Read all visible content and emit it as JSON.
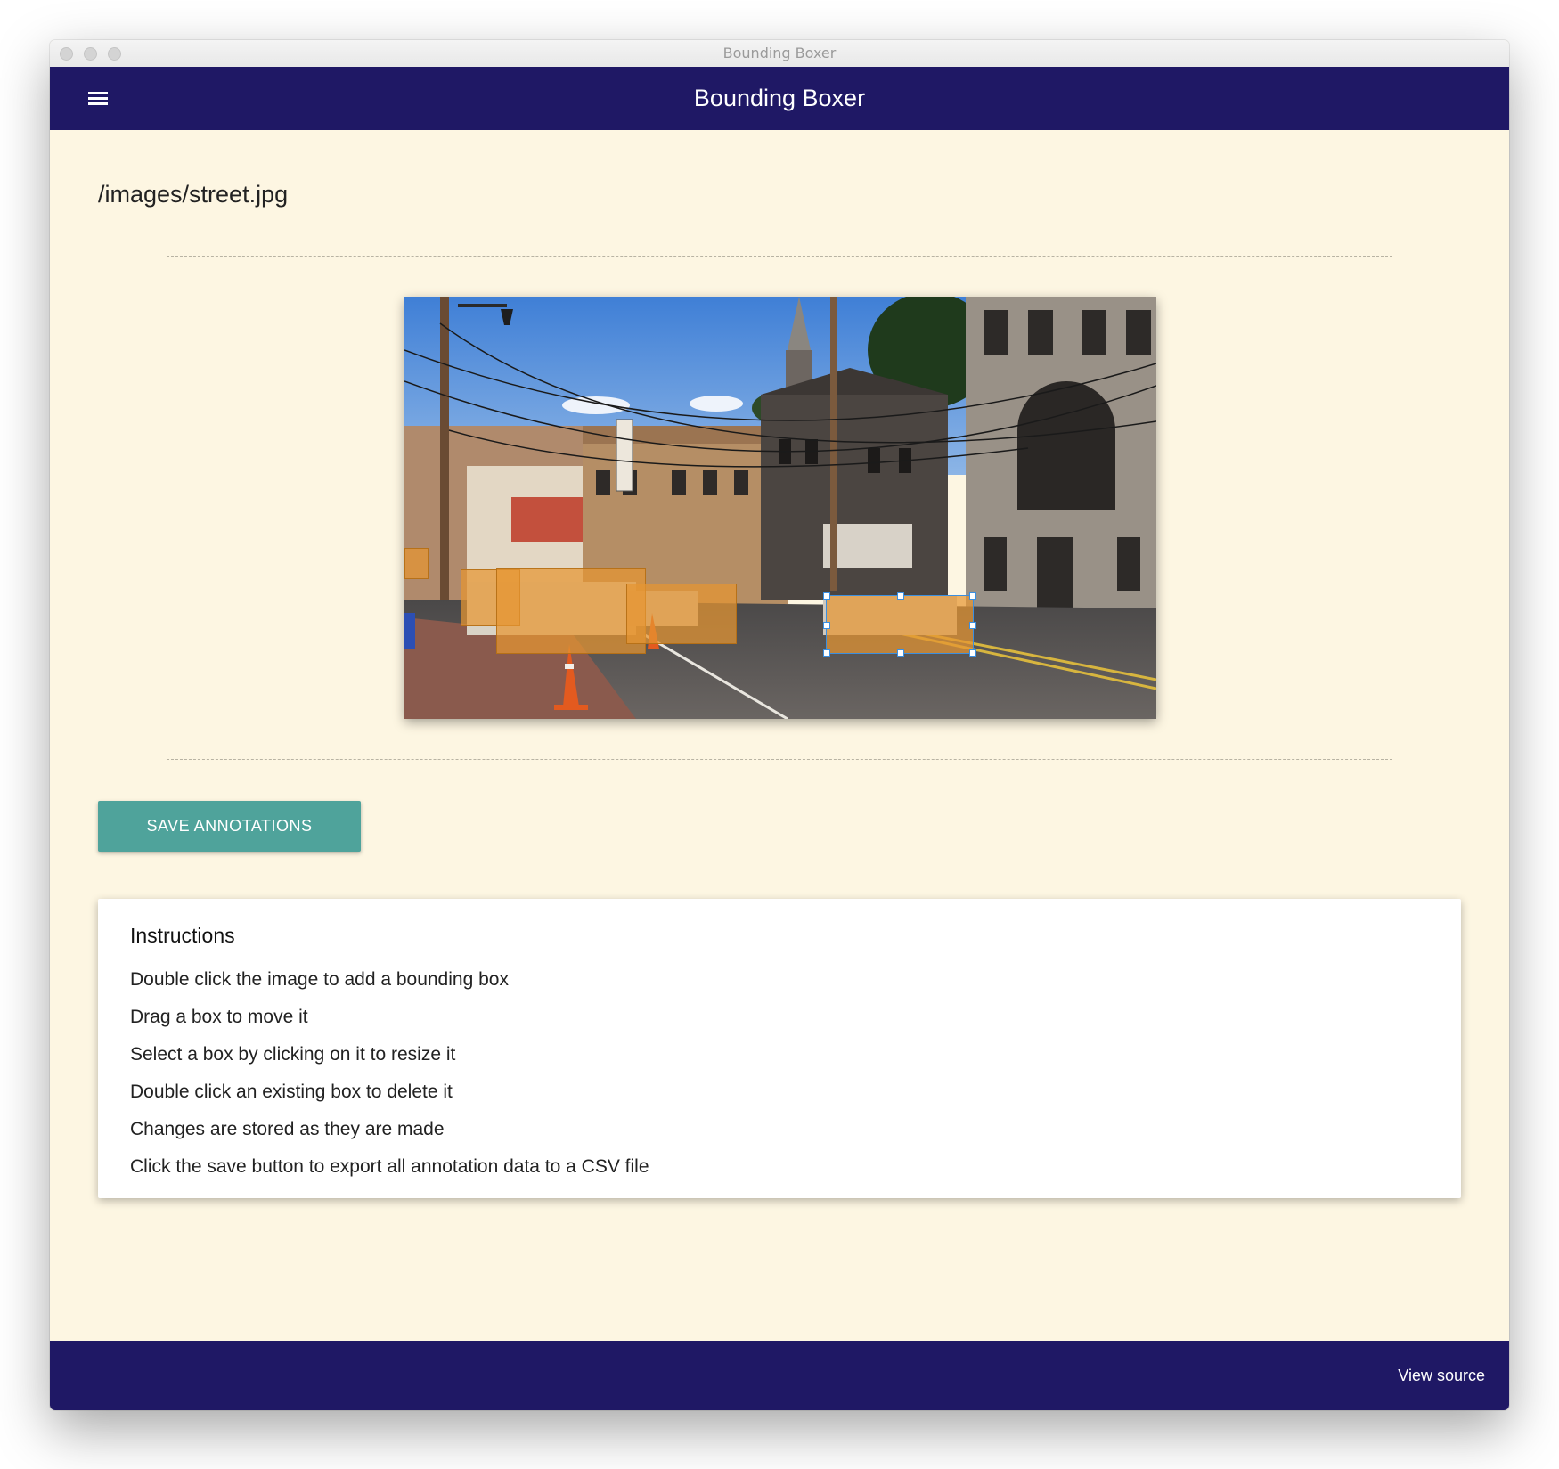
{
  "window": {
    "title": "Bounding Boxer"
  },
  "appbar": {
    "title": "Bounding Boxer",
    "menu_icon": "menu-icon"
  },
  "main": {
    "file_path": "/images/street.jpg",
    "image_icon": "street-photo",
    "boxes": [
      {
        "label": "box-1",
        "selected": false
      },
      {
        "label": "box-2",
        "selected": false
      },
      {
        "label": "box-3",
        "selected": false
      },
      {
        "label": "box-4",
        "selected": false
      },
      {
        "label": "box-5",
        "selected": true
      }
    ],
    "save_label": "SAVE ANNOTATIONS"
  },
  "instructions": {
    "title": "Instructions",
    "items": [
      "Double click the image to add a bounding box",
      "Drag a box to move it",
      "Select a box by clicking on it to resize it",
      "Double click an existing box to delete it",
      "Changes are stored as they are made",
      "Click the save button to export all annotation data to a CSV file"
    ]
  },
  "footer": {
    "view_source_label": "View source"
  },
  "colors": {
    "appbar": "#1f1865",
    "background": "#fdf6e2",
    "button": "#4fa39b",
    "box_fill": "#e6962f",
    "selection": "#3b8fe0"
  }
}
